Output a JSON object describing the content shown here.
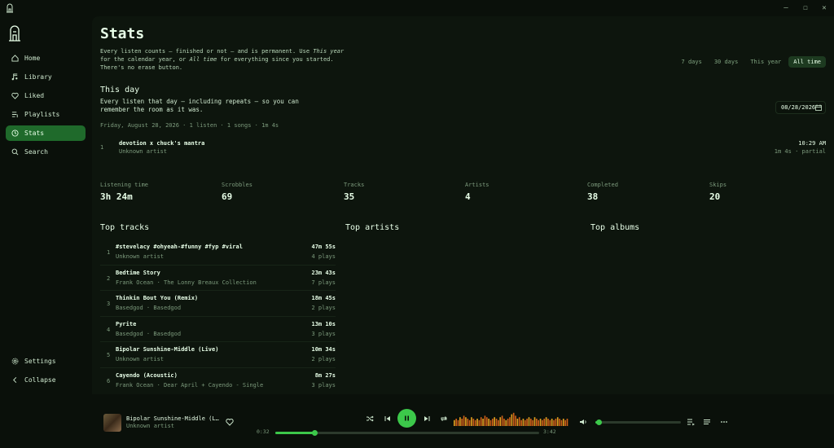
{
  "window": {
    "minimize": "—",
    "maximize": "☐",
    "close": "✕"
  },
  "sidebar": {
    "items": [
      {
        "label": "Home",
        "icon": "home-icon"
      },
      {
        "label": "Library",
        "icon": "library-icon"
      },
      {
        "label": "Liked",
        "icon": "heart-icon"
      },
      {
        "label": "Playlists",
        "icon": "playlist-icon"
      },
      {
        "label": "Stats",
        "icon": "clock-icon",
        "active": true
      },
      {
        "label": "Search",
        "icon": "search-icon"
      }
    ],
    "settings": "Settings",
    "collapse": "Collapse"
  },
  "page": {
    "title": "Stats",
    "desc_a": "Every listen counts — finished or not — and is permanent. Use ",
    "desc_em1": "This year",
    "desc_b": " for the calendar year, or ",
    "desc_em2": "All time",
    "desc_c": " for everything since you started. There's no erase button."
  },
  "range_tabs": [
    "7 days",
    "30 days",
    "This year",
    "All time"
  ],
  "range_active": "All time",
  "this_day": {
    "heading": "This day",
    "desc": "Every listen that day — including repeats — so you can remember the room as it was.",
    "date": "08/28/2026",
    "summary": "Friday, August 28, 2026 · 1 listen · 1 songs · 1m 4s",
    "listens": [
      {
        "idx": "1",
        "title": "devotion x chuck's mantra",
        "artist": "Unknown artist",
        "time": "10:29 AM",
        "info": "1m 4s · partial"
      }
    ]
  },
  "metrics": [
    {
      "label": "Listening time",
      "value": "3h 24m"
    },
    {
      "label": "Scrobbles",
      "value": "69"
    },
    {
      "label": "Tracks",
      "value": "35"
    },
    {
      "label": "Artists",
      "value": "4"
    },
    {
      "label": "Completed",
      "value": "38"
    },
    {
      "label": "Skips",
      "value": "20"
    }
  ],
  "top": {
    "tracks_heading": "Top tracks",
    "artists_heading": "Top artists",
    "albums_heading": "Top albums",
    "tracks": [
      {
        "idx": "1",
        "title": "#stevelacy #ohyeah-#funny #fyp #viral",
        "sub": "Unknown artist",
        "duration": "47m 55s",
        "plays": "4 plays"
      },
      {
        "idx": "2",
        "title": "Bedtime Story",
        "sub": "Frank Ocean · The Lonny Breaux Collection",
        "duration": "23m 43s",
        "plays": "7 plays"
      },
      {
        "idx": "3",
        "title": "Thinkin Bout You (Remix)",
        "sub": "Basedgod · Basedgod",
        "duration": "18m 45s",
        "plays": "2 plays"
      },
      {
        "idx": "4",
        "title": "Pyrite",
        "sub": "Basedgod · Basedgod",
        "duration": "13m 10s",
        "plays": "3 plays"
      },
      {
        "idx": "5",
        "title": "Bipolar Sunshine-Middle (Live)",
        "sub": "Unknown artist",
        "duration": "10m 34s",
        "plays": "2 plays"
      },
      {
        "idx": "6",
        "title": "Cayendo (Acoustic)",
        "sub": "Frank Ocean · Dear April + Cayendo - Single",
        "duration": "8m 27s",
        "plays": "3 plays"
      }
    ]
  },
  "player": {
    "title": "Bipolar Sunshine-Middle (L…",
    "artist": "Unknown artist",
    "elapsed": "0:32",
    "total": "3:42",
    "progress": 0.147,
    "volume": 0.04,
    "accent": "#3cc84a",
    "wave": [
      4,
      5,
      4,
      6,
      5,
      7,
      6,
      5,
      4,
      6,
      5,
      4,
      5,
      4,
      6,
      5,
      7,
      6,
      5,
      4,
      5,
      6,
      5,
      4,
      6,
      7,
      5,
      4,
      5,
      6,
      8,
      9,
      7,
      5,
      6,
      4,
      5,
      4,
      5,
      6,
      5,
      4,
      6,
      5,
      4,
      5,
      4,
      5,
      6,
      5,
      4,
      5,
      4,
      5,
      6,
      5,
      4,
      5,
      4,
      5
    ]
  }
}
